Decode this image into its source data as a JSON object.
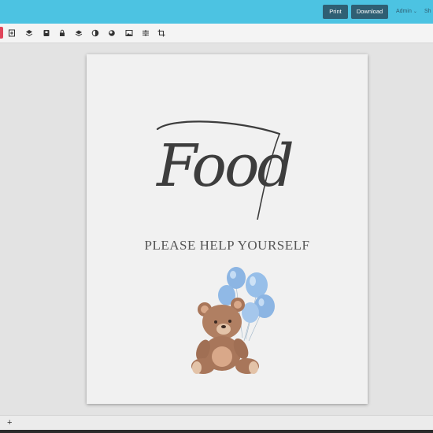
{
  "header": {
    "print_label": "Print",
    "download_label": "Download",
    "user_label": "Admin",
    "share_label": "Sh",
    "bar_color": "#4cc3e2",
    "button_color": "#2f5f73"
  },
  "toolbar": {
    "accent_color": "#e0455a",
    "tools": [
      "add-page-icon",
      "layers-icon",
      "book-icon",
      "lock-icon",
      "stack-icon",
      "contrast-icon",
      "shading-icon",
      "image-icon",
      "align-icon",
      "crop-icon"
    ]
  },
  "document": {
    "title": "Food",
    "subtitle": "PLEASE HELP YOURSELF",
    "illustration": "teddy-bear-with-blue-balloons"
  },
  "footer": {
    "add_label": "+"
  }
}
